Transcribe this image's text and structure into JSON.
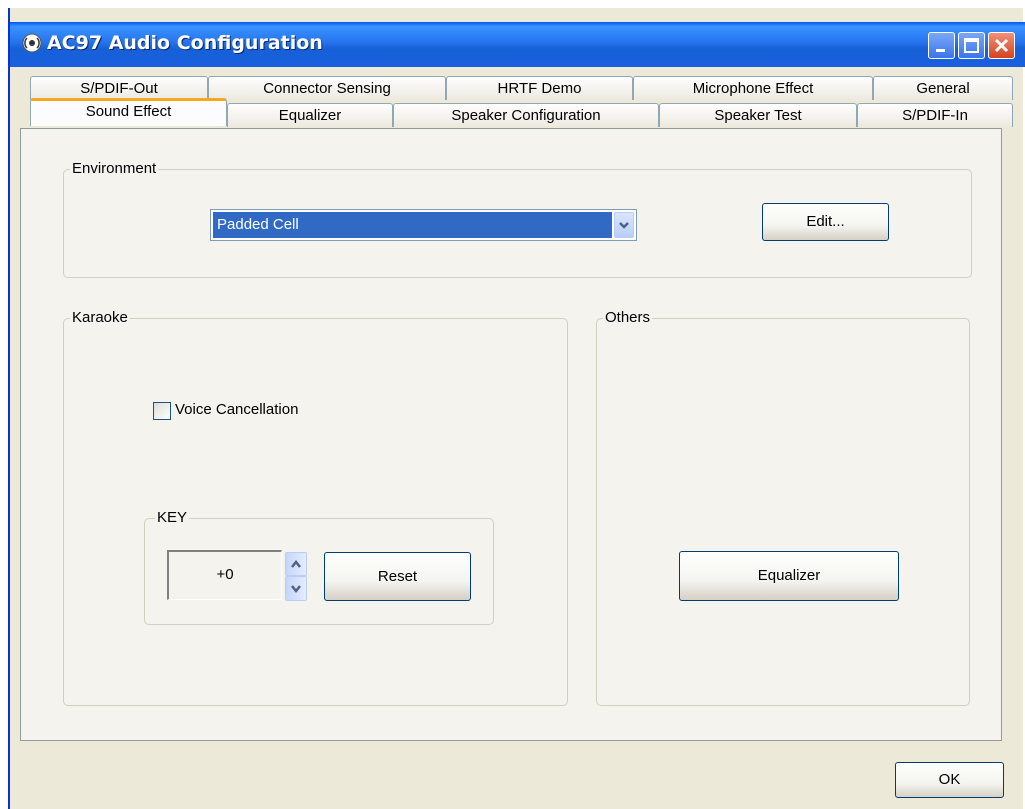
{
  "window": {
    "title": "AC97 Audio Configuration"
  },
  "tabs": {
    "back_row": [
      {
        "label": "S/PDIF-Out"
      },
      {
        "label": "Connector Sensing"
      },
      {
        "label": "HRTF Demo"
      },
      {
        "label": "Microphone Effect"
      },
      {
        "label": "General"
      }
    ],
    "front_row": [
      {
        "label": "Sound Effect",
        "active": true
      },
      {
        "label": "Equalizer"
      },
      {
        "label": "Speaker Configuration"
      },
      {
        "label": "Speaker Test"
      },
      {
        "label": "S/PDIF-In"
      }
    ]
  },
  "environment": {
    "legend": "Environment",
    "selected": "Padded Cell",
    "edit_label": "Edit..."
  },
  "karaoke": {
    "legend": "Karaoke",
    "voice_cancellation_label": "Voice Cancellation",
    "voice_cancellation_checked": false,
    "key": {
      "legend": "KEY",
      "value": "+0",
      "reset_label": "Reset"
    }
  },
  "others": {
    "legend": "Others",
    "equalizer_label": "Equalizer"
  },
  "footer": {
    "ok_label": "OK"
  },
  "colors": {
    "titlebar": "#0058ee",
    "selection": "#316ac5",
    "active_tab_accent": "#f5a623",
    "window_bg": "#ece9d8"
  },
  "icons": [
    "speaker-app-icon",
    "minimize-icon",
    "maximize-icon",
    "close-icon",
    "chevron-down-icon",
    "spin-up-icon",
    "spin-down-icon"
  ]
}
